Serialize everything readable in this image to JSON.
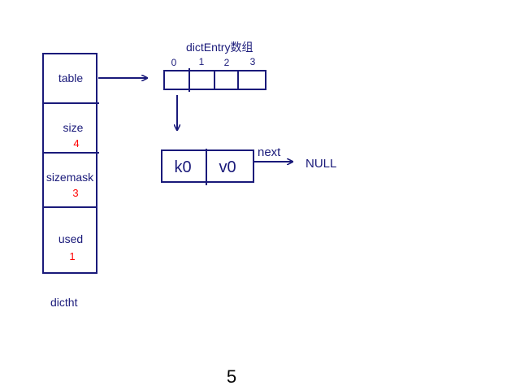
{
  "dictht": {
    "title": "dictht",
    "fields": [
      {
        "name": "table",
        "value": ""
      },
      {
        "name": "size",
        "value": "4"
      },
      {
        "name": "sizemask",
        "value": "3"
      },
      {
        "name": "used",
        "value": "1"
      }
    ]
  },
  "array": {
    "title": "dictEntry数组",
    "indices": [
      "0",
      "1",
      "2",
      "3"
    ]
  },
  "entry": {
    "key": "k0",
    "value": "v0",
    "next_label": "next",
    "null_label": "NULL"
  },
  "page_number": "5",
  "colors": {
    "stroke": "#1a1a7a",
    "label": "#1a1a7a",
    "value": "#ff0000",
    "text": "#000000"
  }
}
